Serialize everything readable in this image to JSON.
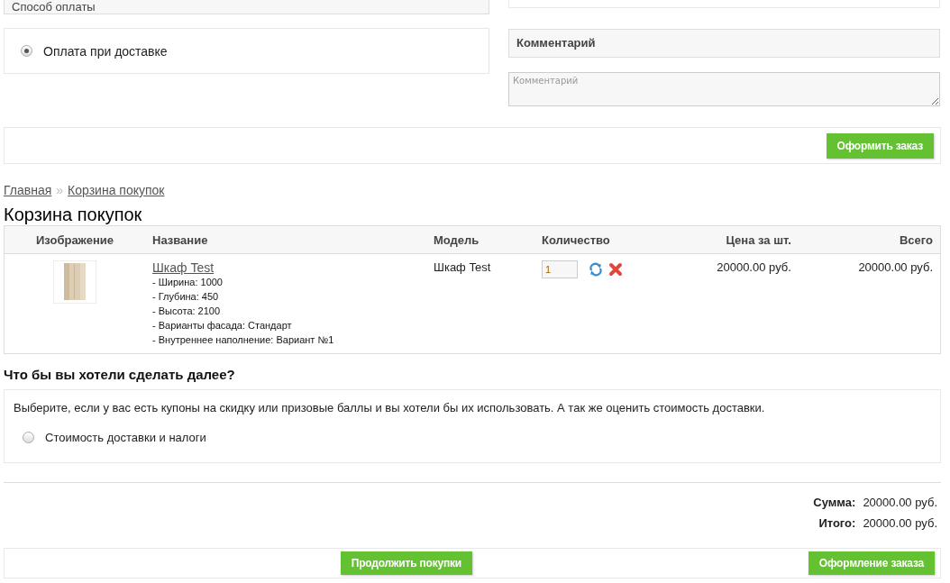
{
  "payment": {
    "header": "Способ оплаты",
    "options": [
      {
        "label": "Оплата при доставке",
        "selected": true
      }
    ]
  },
  "comment": {
    "header": "Комментарий",
    "placeholder": "Комментарий"
  },
  "confirm_button": "Оформить заказ",
  "breadcrumbs": {
    "items": [
      "Главная",
      "Корзина покупок"
    ],
    "separator": "»"
  },
  "title": "Корзина покупок",
  "cart": {
    "columns": [
      "Изображение",
      "Название",
      "Модель",
      "Количество",
      "Цена за шт.",
      "Всего"
    ],
    "rows": [
      {
        "name": "Шкаф Test",
        "options": [
          "- Ширина: 1000",
          "- Глубина: 450",
          "- Высота: 2100",
          "- Варианты фасада: Стандарт",
          "- Внутреннее наполнение: Вариант №1"
        ],
        "model": "Шкаф Test",
        "quantity": "1",
        "unit_price": "20000.00 руб.",
        "total": "20000.00 руб."
      }
    ]
  },
  "next": {
    "title": "Что бы вы хотели сделать далее?",
    "description": "Выберите, если у вас есть купоны на скидку или призовые баллы и вы хотели бы их использовать. А так же оценить стоимость доставки.",
    "options": [
      {
        "label": "Стоимость доставки и налоги",
        "selected": false
      }
    ]
  },
  "totals": [
    {
      "label": "Сумма:",
      "value": "20000.00 руб."
    },
    {
      "label": "Итого:",
      "value": "20000.00 руб."
    }
  ],
  "buttons": {
    "continue": "Продолжить покупки",
    "checkout": "Оформление заказа"
  }
}
